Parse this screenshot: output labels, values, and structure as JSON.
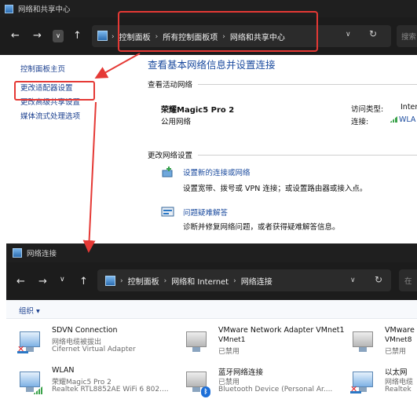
{
  "window1": {
    "title": "网络和共享中心",
    "breadcrumb": [
      "控制面板",
      "所有控制面板项",
      "网络和共享中心"
    ],
    "search_placeholder": "搜索",
    "left_nav": [
      "控制面板主页",
      "更改适配器设置",
      "更改高级共享设置",
      "媒体流式处理选项"
    ],
    "main_title": "查看基本网络信息并设置连接",
    "active_networks_label": "查看活动网络",
    "network": {
      "name": "荣耀Magic5 Pro 2",
      "type": "公用网络",
      "access_type_label": "访问类型:",
      "access_type_value": "Inter",
      "connection_label": "连接:",
      "connection_value": "WLA"
    },
    "change_settings_label": "更改网络设置",
    "tasks": [
      {
        "link": "设置新的连接或网络",
        "desc": "设置宽带、拨号或 VPN 连接；或设置路由器或接入点。"
      },
      {
        "link": "问题疑难解答",
        "desc": "诊断并修复网络问题，或者获得疑难解答信息。"
      }
    ]
  },
  "window2": {
    "title": "网络连接",
    "breadcrumb": [
      "控制面板",
      "网络和 Internet",
      "网络连接"
    ],
    "search_placeholder": "在",
    "organize_label": "组织 ▾",
    "connections": [
      {
        "name": "SDVN Connection",
        "status": "网络电缆被拔出",
        "device": "Cifernet Virtual Adapter"
      },
      {
        "name": "VMware Network Adapter VMnet1",
        "status": "已禁用",
        "device": ""
      },
      {
        "name": "VMware",
        "status": "VMnet8",
        "device": "已禁用"
      },
      {
        "name": "WLAN",
        "status": "荣耀Magic5 Pro 2",
        "device": "Realtek RTL8852AE WiFi 6 802...."
      },
      {
        "name": "蓝牙网络连接",
        "status": "已禁用",
        "device": "Bluetooth Device (Personal Ar...."
      },
      {
        "name": "以太网",
        "status": "网络电缆",
        "device": "Realtek"
      }
    ]
  },
  "colors": {
    "annotation": "#e53935",
    "link": "#1a4a9e",
    "titlebar": "#1f1f1f"
  }
}
